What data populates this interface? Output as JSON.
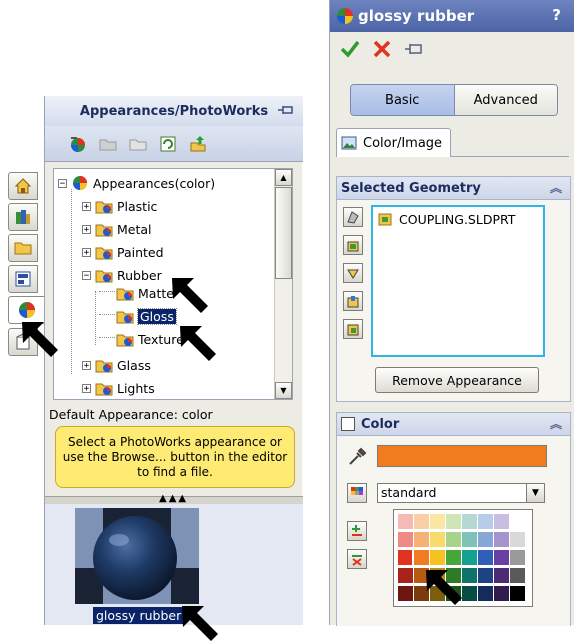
{
  "left_panel": {
    "title": "Appearances/PhotoWorks",
    "tree": {
      "root": "Appearances(color)",
      "items": [
        "Plastic",
        "Metal",
        "Painted",
        "Rubber",
        "Matte",
        "Gloss",
        "Texture",
        "Glass",
        "Lights"
      ]
    },
    "default_appearance": "Default Appearance: color",
    "hint": "Select a PhotoWorks appearance or use the Browse... button in the editor to find a file.",
    "preview_label": "glossy rubber"
  },
  "right_panel": {
    "title": "glossy rubber",
    "help": "?",
    "mode_basic": "Basic",
    "mode_advanced": "Advanced",
    "tab_color_image": "Color/Image",
    "selected_geometry": {
      "header": "Selected Geometry",
      "items": [
        "COUPLING.SLDPRT"
      ],
      "remove_button": "Remove Appearance"
    },
    "color_section": {
      "header": "Color",
      "swatch_color": "#f07c1f",
      "palette_selection": "standard"
    }
  },
  "icons": [
    "pin-icon",
    "appearance-ball-icon",
    "checkmark-icon",
    "cancel-icon",
    "eyedropper-icon",
    "folder-icon",
    "home-icon"
  ]
}
